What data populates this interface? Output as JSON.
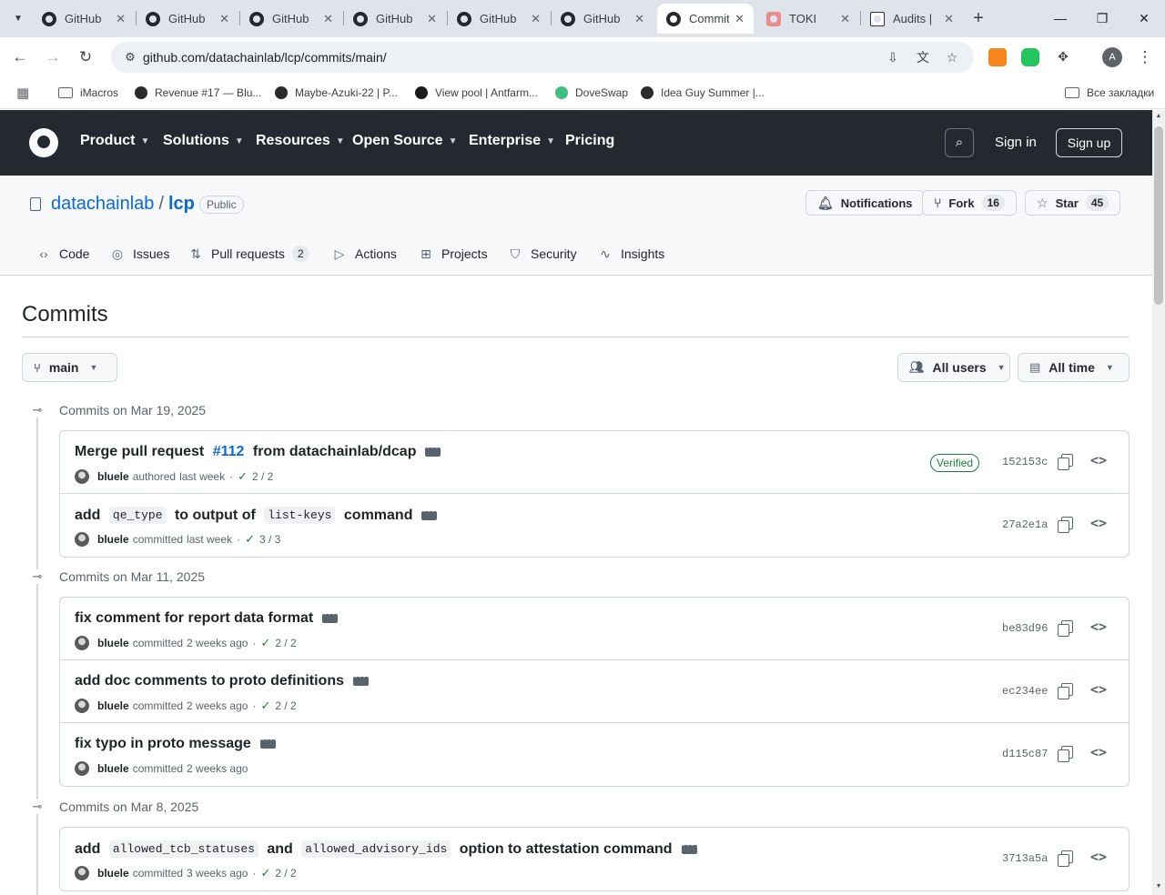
{
  "browser": {
    "tabs": [
      {
        "title": "GitHub",
        "active": false
      },
      {
        "title": "GitHub",
        "active": false
      },
      {
        "title": "GitHub",
        "active": false
      },
      {
        "title": "GitHub",
        "active": false
      },
      {
        "title": "GitHub",
        "active": false
      },
      {
        "title": "GitHub",
        "active": false
      },
      {
        "title": "Commit",
        "active": true
      },
      {
        "title": "TOKI",
        "active": false
      },
      {
        "title": "Audits |",
        "active": false
      }
    ],
    "url": "github.com/datachainlab/lcp/commits/main/",
    "profile_initial": "A",
    "bookmarks": [
      {
        "label": "iMacros",
        "icon": "folder-icon"
      },
      {
        "label": "Revenue #17 — Blu...",
        "icon": "site-icon",
        "color": "#2b2b2b"
      },
      {
        "label": "Maybe-Azuki-22 | P...",
        "icon": "site-icon",
        "color": "#2b2b2b"
      },
      {
        "label": "View pool | Antfarm...",
        "icon": "site-icon",
        "color": "#1a1a1a"
      },
      {
        "label": "DoveSwap",
        "icon": "site-icon",
        "color": "#3fbf7f"
      },
      {
        "label": "Idea Guy Summer |...",
        "icon": "site-icon",
        "color": "#2b2b2b"
      }
    ],
    "all_bookmarks": "Все закладки"
  },
  "gh_header": {
    "nav": [
      "Product",
      "Solutions",
      "Resources",
      "Open Source",
      "Enterprise",
      "Pricing"
    ],
    "sign_in": "Sign in",
    "sign_up": "Sign up"
  },
  "repo": {
    "owner": "datachainlab",
    "name": "lcp",
    "visibility": "Public",
    "notifications": "Notifications",
    "fork_label": "Fork",
    "fork_count": "16",
    "star_label": "Star",
    "star_count": "45",
    "tabs": [
      {
        "label": "Code",
        "icon": "code-icon"
      },
      {
        "label": "Issues",
        "icon": "issue-icon"
      },
      {
        "label": "Pull requests",
        "icon": "pull-request-icon",
        "count": "2"
      },
      {
        "label": "Actions",
        "icon": "play-icon"
      },
      {
        "label": "Projects",
        "icon": "table-icon"
      },
      {
        "label": "Security",
        "icon": "shield-icon"
      },
      {
        "label": "Insights",
        "icon": "graph-icon"
      }
    ]
  },
  "page": {
    "title": "Commits",
    "branch": "main",
    "users_filter": "All users",
    "time_filter": "All time"
  },
  "commit_days": [
    {
      "label": "Commits on Mar 19, 2025",
      "commits": [
        {
          "title_parts": [
            {
              "t": "Merge pull request "
            },
            {
              "t": "#112",
              "pr": true
            },
            {
              "t": " from datachainlab/dcap"
            }
          ],
          "author": "bluele",
          "action": "authored",
          "when": "last week",
          "checks": "2 / 2",
          "verified": "Verified",
          "sha": "152153c"
        },
        {
          "title_parts": [
            {
              "t": "add "
            },
            {
              "t": "qe_type",
              "code": true
            },
            {
              "t": " to output of "
            },
            {
              "t": "list-keys",
              "code": true
            },
            {
              "t": " command"
            }
          ],
          "author": "bluele",
          "action": "committed",
          "when": "last week",
          "checks": "3 / 3",
          "verified": "",
          "sha": "27a2e1a"
        }
      ]
    },
    {
      "label": "Commits on Mar 11, 2025",
      "commits": [
        {
          "title_parts": [
            {
              "t": "fix comment for report data format"
            }
          ],
          "author": "bluele",
          "action": "committed",
          "when": "2 weeks ago",
          "checks": "2 / 2",
          "verified": "",
          "sha": "be83d96"
        },
        {
          "title_parts": [
            {
              "t": "add doc comments to proto definitions"
            }
          ],
          "author": "bluele",
          "action": "committed",
          "when": "2 weeks ago",
          "checks": "2 / 2",
          "verified": "",
          "sha": "ec234ee"
        },
        {
          "title_parts": [
            {
              "t": "fix typo in proto message"
            }
          ],
          "author": "bluele",
          "action": "committed",
          "when": "2 weeks ago",
          "checks": "",
          "verified": "",
          "sha": "d115c87"
        }
      ]
    },
    {
      "label": "Commits on Mar 8, 2025",
      "commits": [
        {
          "title_parts": [
            {
              "t": "add "
            },
            {
              "t": "allowed_tcb_statuses",
              "code": true
            },
            {
              "t": " and "
            },
            {
              "t": "allowed_advisory_ids",
              "code": true
            },
            {
              "t": " option to attestation command"
            }
          ],
          "author": "bluele",
          "action": "committed",
          "when": "3 weeks ago",
          "checks": "2 / 2",
          "verified": "",
          "sha": "3713a5a"
        }
      ]
    }
  ]
}
